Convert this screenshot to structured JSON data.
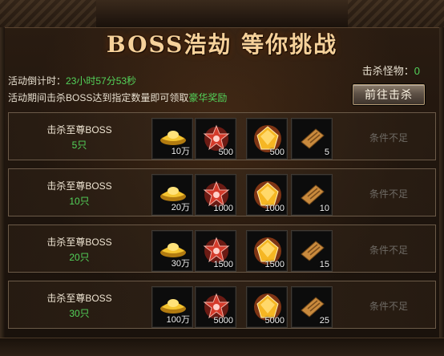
{
  "title": "BOSS浩劫 等你挑战",
  "kill_monsters": {
    "label": "击杀怪物：",
    "value": "0"
  },
  "countdown": {
    "label": "活动倒计时：",
    "value": "23小时57分53秒"
  },
  "description": {
    "text": "活动期间击杀BOSS达到指定数量即可领取",
    "highlight": "豪华奖励"
  },
  "go_button": "前往击杀",
  "rows": [
    {
      "label": "击杀至尊BOSS",
      "count": "5只",
      "rewards": {
        "gold": "10万",
        "emblem": "500",
        "gem": "500",
        "scroll": "5"
      },
      "status": "条件不足"
    },
    {
      "label": "击杀至尊BOSS",
      "count": "10只",
      "rewards": {
        "gold": "20万",
        "emblem": "1000",
        "gem": "1000",
        "scroll": "10"
      },
      "status": "条件不足"
    },
    {
      "label": "击杀至尊BOSS",
      "count": "20只",
      "rewards": {
        "gold": "30万",
        "emblem": "1500",
        "gem": "1500",
        "scroll": "15"
      },
      "status": "条件不足"
    },
    {
      "label": "击杀至尊BOSS",
      "count": "30只",
      "rewards": {
        "gold": "100万",
        "emblem": "5000",
        "gem": "5000",
        "scroll": "25"
      },
      "status": "条件不足"
    }
  ],
  "icons": {
    "gold": "gold-ingot-icon",
    "emblem": "red-emblem-icon",
    "gem": "gold-gem-icon",
    "scroll": "scroll-icon"
  },
  "colors": {
    "highlight_green": "#53d35a",
    "title_gold": "#f6d19a",
    "muted_status": "#6e6a64"
  }
}
